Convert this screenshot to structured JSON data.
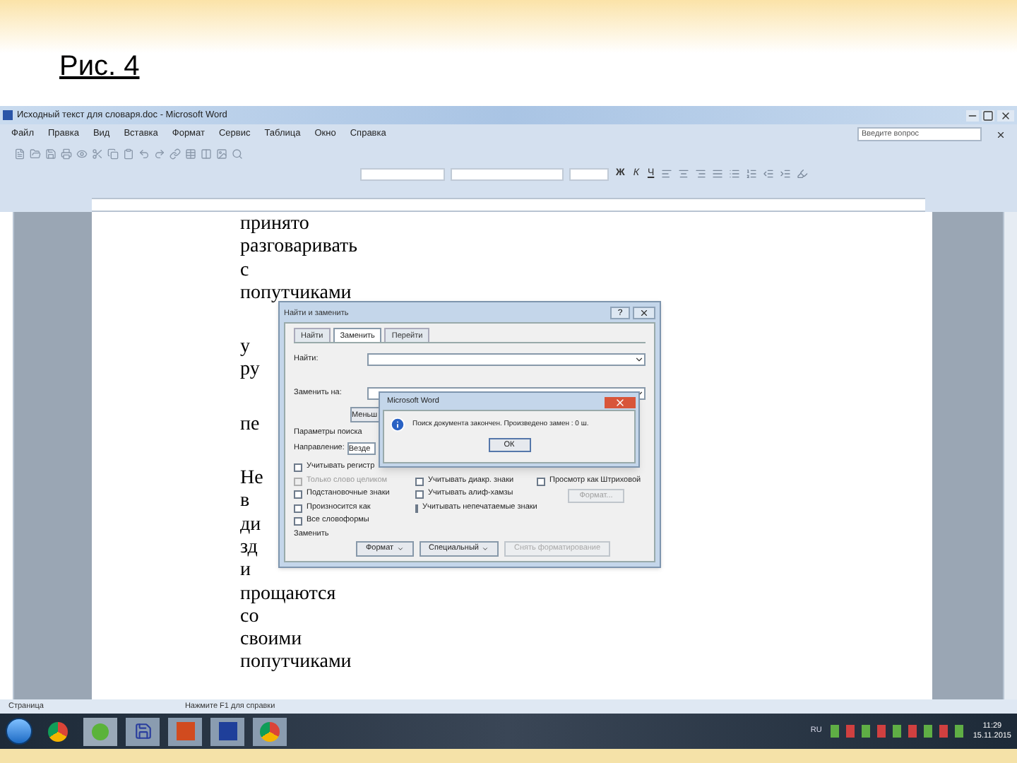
{
  "slide": {
    "title": "Рис. 4"
  },
  "window": {
    "title": "Исходный текст для словаря.doc - Microsoft Word",
    "help_placeholder": "Введите вопрос"
  },
  "menu": [
    "Файл",
    "Правка",
    "Вид",
    "Вставка",
    "Формат",
    "Сервис",
    "Таблица",
    "Окно",
    "Справка"
  ],
  "format_bar": {
    "bold": "Ж",
    "italic": "К",
    "underline": "Ч"
  },
  "document": {
    "paragraphs": [
      {
        "lines": [
          "принято",
          "разговаривать",
          "с",
          "попутчиками"
        ]
      },
      {
        "lines": [
          "у",
          "ру"
        ]
      },
      {
        "lines": [
          "пе"
        ]
      },
      {
        "lines": [
          "Не",
          "в",
          "ди",
          "зд",
          "и",
          "прощаются",
          "со",
          "своими",
          "попутчиками"
        ]
      }
    ]
  },
  "dialog": {
    "title": "Найти и заменить",
    "help_button": "?",
    "tabs": [
      {
        "label": "Найти",
        "selected": false
      },
      {
        "label": "Заменить",
        "selected": true
      },
      {
        "label": "Перейти",
        "selected": false
      }
    ],
    "find_label": "Найти:",
    "replace_label": "Заменить на:",
    "less_button": "Меньш",
    "options_label": "Параметры поиска",
    "direction_label": "Направление:",
    "direction_value": "Везде",
    "option_columns": [
      [
        {
          "label": "Учитывать регистр",
          "checked": false,
          "disabled": false
        },
        {
          "label": "Только слово целиком",
          "checked": false,
          "disabled": true
        },
        {
          "label": "Подстановочные знаки",
          "checked": false,
          "disabled": false
        },
        {
          "label": "Произносится как",
          "checked": false,
          "disabled": false
        },
        {
          "label": "Все словоформы",
          "checked": false,
          "disabled": false
        }
      ],
      [
        {
          "label": "Учитывать диакр. знаки",
          "checked": false,
          "disabled": false
        },
        {
          "label": "Учитывать алиф-хамзы",
          "checked": false,
          "disabled": false
        },
        {
          "label": "Учитывать непечатаемые знаки",
          "checked": false,
          "disabled": false
        }
      ],
      [
        {
          "label": "Просмотр как Штриховой",
          "checked": false,
          "disabled": false
        }
      ]
    ],
    "side_button": {
      "label": "Формат...",
      "disabled": true
    },
    "replace_section": "Заменить",
    "buttons": [
      {
        "label": "Формат",
        "dropdown": true,
        "disabled": false
      },
      {
        "label": "Специальный",
        "dropdown": true,
        "disabled": false
      },
      {
        "label": "Снять форматирование",
        "dropdown": false,
        "disabled": true
      }
    ]
  },
  "message": {
    "title": "Microsoft Word",
    "text": "Поиск документа закончен. Произведено замен : 0 ш.",
    "ok": "ОК"
  },
  "status_bar": {
    "page": "Страница",
    "hint": "Нажмите F1 для справки"
  },
  "taskbar": {
    "language": "RU",
    "time": "11:29",
    "date": "15.11.2015"
  }
}
